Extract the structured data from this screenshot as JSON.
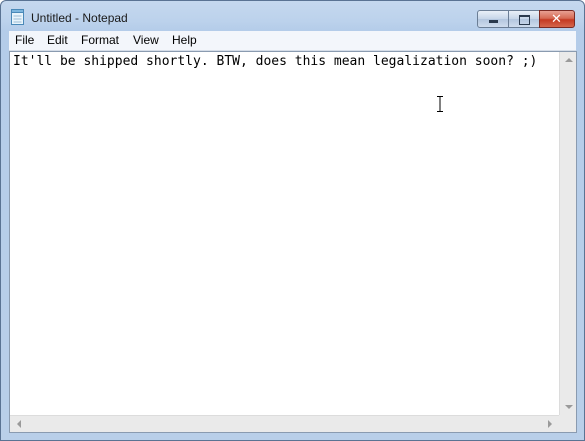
{
  "window": {
    "title": "Untitled - Notepad",
    "icons": {
      "app": "notepad-icon",
      "minimize": "minimize-icon",
      "maximize": "maximize-icon",
      "close": "close-icon"
    },
    "close_glyph": "✕"
  },
  "menu": {
    "items": [
      {
        "label": "File"
      },
      {
        "label": "Edit"
      },
      {
        "label": "Format"
      },
      {
        "label": "View"
      },
      {
        "label": "Help"
      }
    ]
  },
  "editor": {
    "content": "It'll be shipped shortly. BTW, does this mean legalization soon? ;)"
  },
  "colors": {
    "frame": "#b9cfe9",
    "close_button": "#c43a22",
    "editor_bg": "#ffffff"
  }
}
